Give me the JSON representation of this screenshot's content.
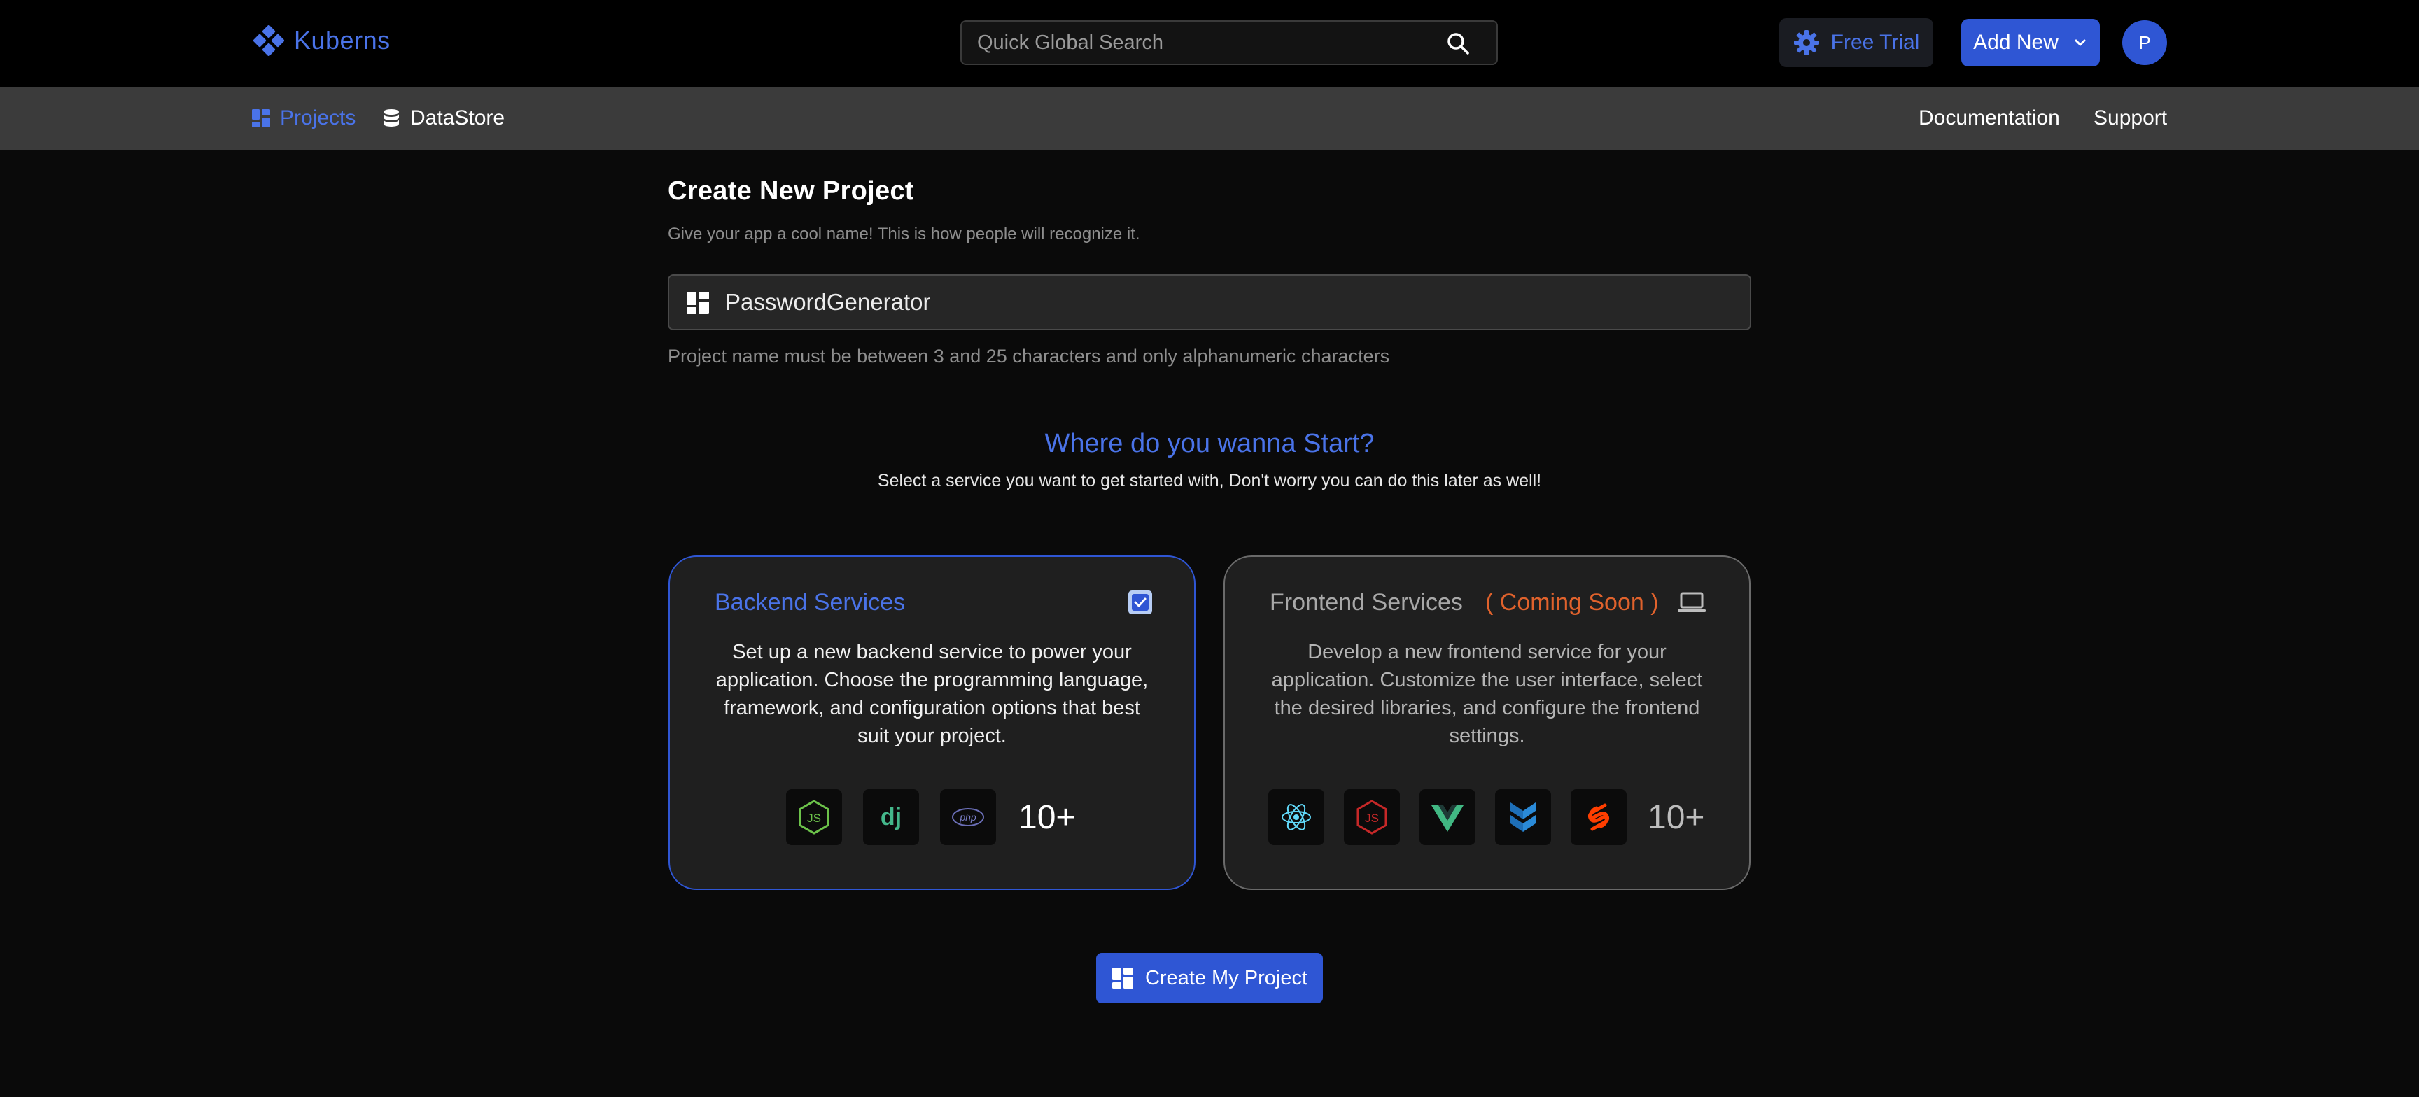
{
  "header": {
    "brand": "Kuberns",
    "search_placeholder": "Quick Global Search",
    "free_trial": "Free Trial",
    "add_new": "Add New",
    "avatar_initial": "P"
  },
  "nav": {
    "projects": "Projects",
    "datastore": "DataStore",
    "documentation": "Documentation",
    "support": "Support"
  },
  "main": {
    "title": "Create New Project",
    "subtitle": "Give your app a cool name! This is how people will recognize it.",
    "project_name_value": "PasswordGenerator",
    "hint": "Project name must be between 3 and 25 characters and only alphanumeric characters",
    "where_title": "Where do you wanna Start?",
    "where_sub": "Select a service you want to get started with, Don't worry you can do this later as well!"
  },
  "cards": {
    "backend": {
      "title": "Backend Services",
      "checked": true,
      "description": "Set up a new backend service to power your application. Choose the programming language, framework, and configuration options that best suit your project.",
      "icons": [
        "nodejs-icon",
        "django-icon",
        "php-icon"
      ],
      "more": "10+"
    },
    "frontend": {
      "title": "Frontend Services",
      "badge": "( Coming Soon )",
      "description": "Develop a new frontend service for your application. Customize the user interface, select the desired libraries, and configure the frontend settings.",
      "icons": [
        "react-icon",
        "javascript-icon",
        "vue-icon",
        "backbone-icon",
        "svelte-icon"
      ],
      "more": "10+"
    }
  },
  "create_button": "Create My Project",
  "colors": {
    "accent": "#2f56d4",
    "accent_text": "#4a73e8",
    "warning": "#e0622c"
  }
}
